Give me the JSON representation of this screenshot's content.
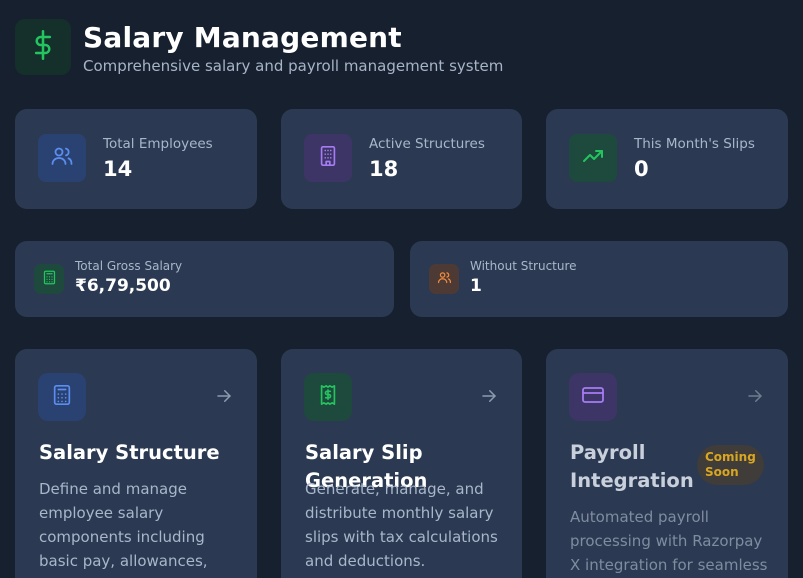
{
  "header": {
    "title": "Salary Management",
    "subtitle": "Comprehensive salary and payroll management system",
    "logo_icon": "dollar-icon"
  },
  "stats": [
    {
      "label": "Total Employees",
      "value": "14",
      "icon": "users-icon",
      "color": "#5b8ef0"
    },
    {
      "label": "Active Structures",
      "value": "18",
      "icon": "building-icon",
      "color": "#a57cf3"
    },
    {
      "label": "This Month's Slips",
      "value": "0",
      "icon": "trending-up-icon",
      "color": "#22c55e"
    }
  ],
  "secondary_stats": [
    {
      "label": "Total Gross Salary",
      "value": "₹6,79,500",
      "icon": "calculator-icon",
      "color": "#22c55e"
    },
    {
      "label": "Without Structure",
      "value": "1",
      "icon": "users-icon",
      "color": "#f08a3c"
    }
  ],
  "features": [
    {
      "title": "Salary Structure",
      "description": "Define and manage employee salary components including basic pay, allowances, and",
      "icon": "calculator-icon",
      "color": "#5b8ef0"
    },
    {
      "title": "Salary Slip Generation",
      "description": "Generate, manage, and distribute monthly salary slips with tax calculations and deductions.",
      "icon": "receipt-icon",
      "color": "#22c55e"
    },
    {
      "title": "Payroll Integration",
      "description": "Automated payroll processing with Razorpay X integration for seamless",
      "icon": "credit-card-icon",
      "color": "#a57cf3",
      "badge": "Coming Soon"
    }
  ]
}
